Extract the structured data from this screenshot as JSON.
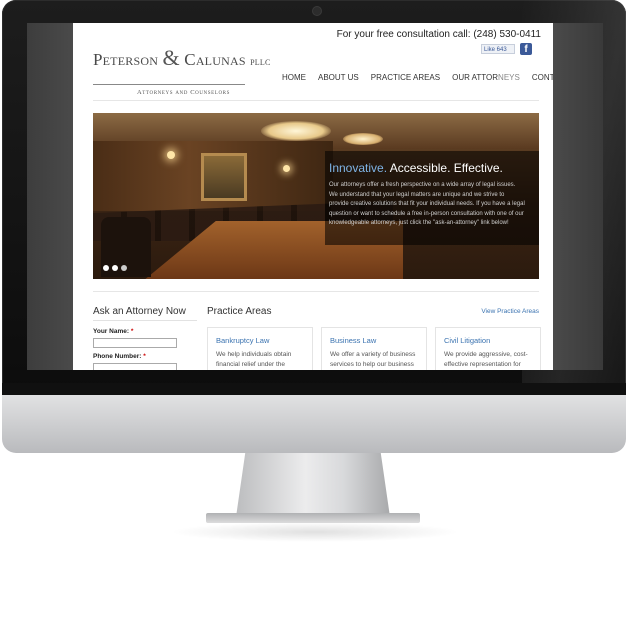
{
  "header": {
    "phone_prefix": "For your free consultation call:",
    "phone_number": "(248) 530-0411",
    "fb_like": "Like  643",
    "fb_icon": "f"
  },
  "logo": {
    "name_1": "Peterson",
    "amp": "&",
    "name_2": "Calunas",
    "suffix": "PLLC",
    "tagline": "Attorneys and Counselors"
  },
  "nav": {
    "items": [
      "HOME",
      "ABOUT US",
      "PRACTICE AREAS",
      "OUR ATTOR",
      "NEYS",
      "CONTACT US"
    ]
  },
  "hero": {
    "tagline_accent": "Innovative.",
    "tagline_rest": "Accessible. Effective.",
    "description": "Our attorneys offer a fresh perspective on a wide array of legal issues. We understand that your legal matters are unique and we strive to provide creative solutions that fit your individual needs. If you have a legal question or want to schedule a free in-person consultation with one of our knowledgeable attorneys, just click the \"ask-an-attorney\" link below!"
  },
  "ask": {
    "title": "Ask an Attorney Now",
    "name_label": "Your Name:",
    "phone_label": "Phone Number:",
    "required_mark": "*",
    "name_value": "",
    "phone_value": ""
  },
  "practice": {
    "title": "Practice Areas",
    "view_link": "View Practice Areas",
    "cards": [
      {
        "title": "Bankruptcy Law",
        "desc": "We help individuals obtain financial relief under the federal"
      },
      {
        "title": "Business Law",
        "desc": "We offer a variety of business services to help our business"
      },
      {
        "title": "Civil Litigation",
        "desc": "We provide aggressive, cost-effective representation for"
      }
    ]
  },
  "colors": {
    "accent_blue": "#3b73b0",
    "tagline_blue": "#7fb4e6",
    "facebook": "#3b5998"
  }
}
